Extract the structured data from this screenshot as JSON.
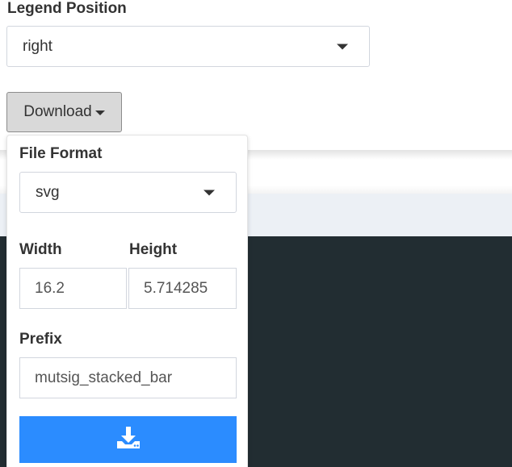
{
  "legend": {
    "label": "Legend Position",
    "selected": "right"
  },
  "download": {
    "button_label": "Download"
  },
  "dropdown": {
    "file_format": {
      "label": "File Format",
      "selected": "svg"
    },
    "width": {
      "label": "Width",
      "value": "16.2"
    },
    "height": {
      "label": "Height",
      "value": "5.714285"
    },
    "prefix": {
      "label": "Prefix",
      "value": "mutsig_stacked_bar"
    },
    "submit": {
      "icon": "download-icon",
      "color": "#2b8cff"
    }
  },
  "colors": {
    "dark_background": "#222d32",
    "gray_band": "#ecf0f5",
    "download_button_bg": "#d9d9d9"
  }
}
